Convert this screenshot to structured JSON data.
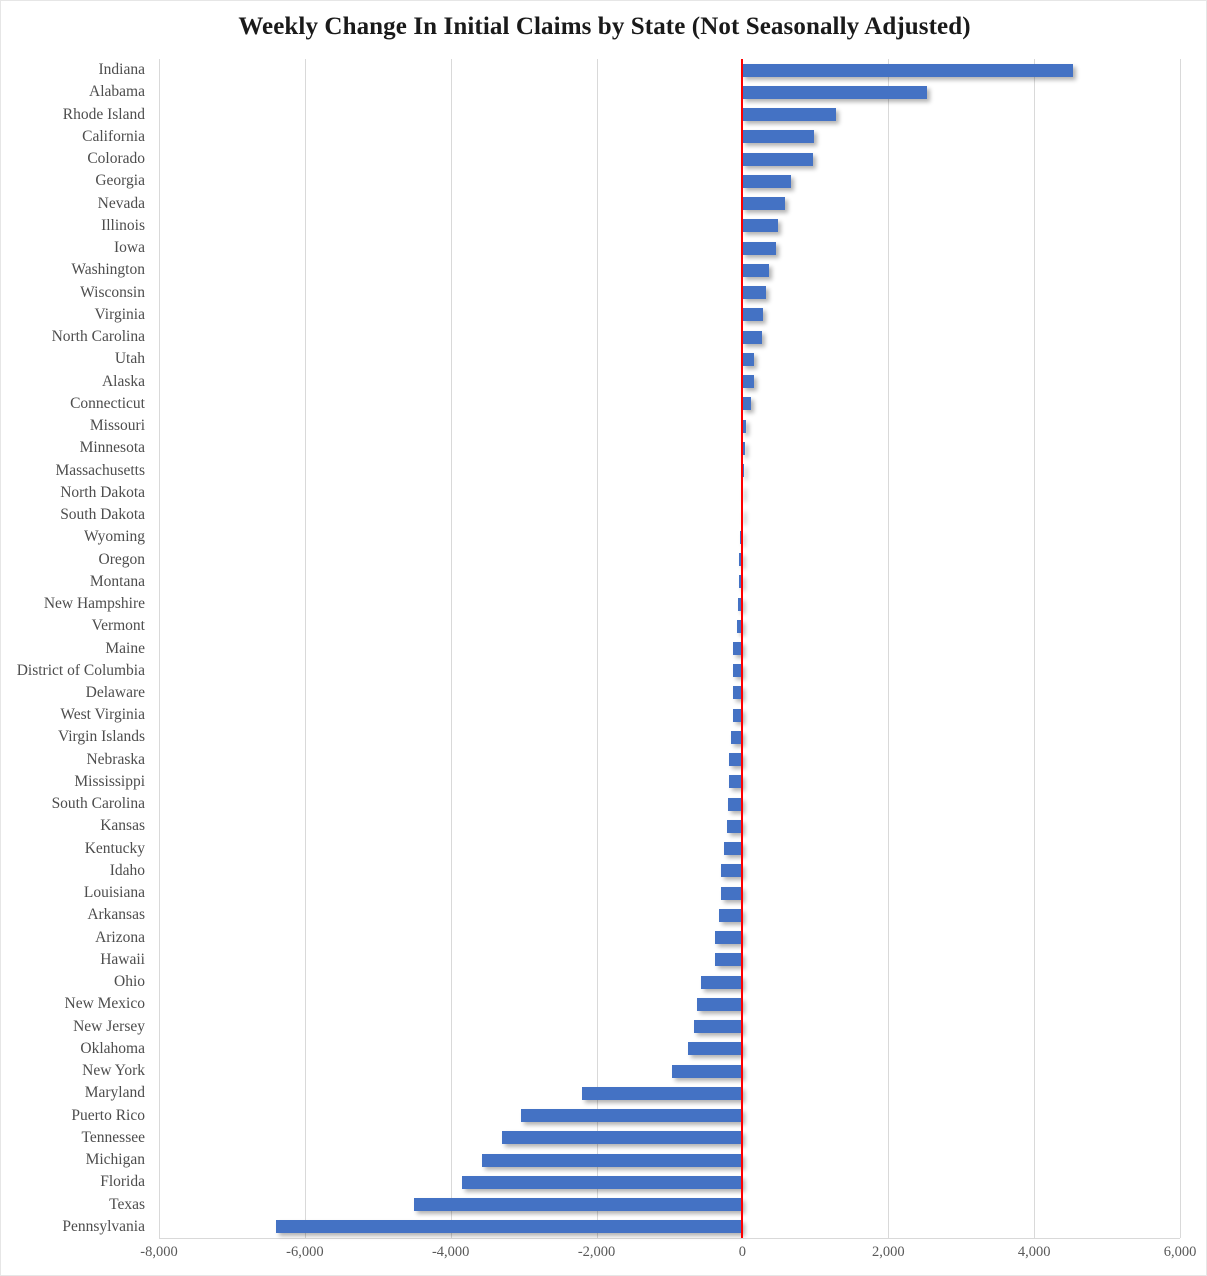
{
  "chart_data": {
    "type": "bar",
    "orientation": "horizontal",
    "title": "Weekly Change In Initial Claims by State (Not Seasonally Adjusted)",
    "xlabel": "",
    "ylabel": "",
    "xlim": [
      -8000,
      6000
    ],
    "xticks": [
      -8000,
      -6000,
      -4000,
      -2000,
      0,
      2000,
      4000,
      6000
    ],
    "xtick_labels": [
      "-8,000",
      "-6,000",
      "-4,000",
      "-2,000",
      "0",
      "2,000",
      "4,000",
      "6,000"
    ],
    "grid": true,
    "legend": "none",
    "bar_color": "#4472C4",
    "zero_line_color": "#FF0000",
    "categories": [
      "Indiana",
      "Alabama",
      "Rhode Island",
      "California",
      "Colorado",
      "Georgia",
      "Nevada",
      "Illinois",
      "Iowa",
      "Washington",
      "Wisconsin",
      "Virginia",
      "North Carolina",
      "Utah",
      "Alaska",
      "Connecticut",
      "Missouri",
      "Minnesota",
      "Massachusetts",
      "North Dakota",
      "South Dakota",
      "Wyoming",
      "Oregon",
      "Montana",
      "New Hampshire",
      "Vermont",
      "Maine",
      "District of Columbia",
      "Delaware",
      "West Virginia",
      "Virgin Islands",
      "Nebraska",
      "Mississippi",
      "South Carolina",
      "Kansas",
      "Kentucky",
      "Idaho",
      "Louisiana",
      "Arkansas",
      "Arizona",
      "Hawaii",
      "Ohio",
      "New Mexico",
      "New Jersey",
      "Oklahoma",
      "New York",
      "Maryland",
      "Puerto Rico",
      "Tennessee",
      "Michigan",
      "Florida",
      "Texas",
      "Pennsylvania"
    ],
    "values": [
      4528,
      2528,
      1290,
      986,
      972,
      667,
      583,
      486,
      458,
      361,
      319,
      278,
      264,
      153,
      153,
      111,
      55,
      42,
      14,
      -14,
      -14,
      -28,
      -42,
      -42,
      -56,
      -69,
      -125,
      -125,
      -125,
      -125,
      -153,
      -180,
      -180,
      -194,
      -208,
      -250,
      -292,
      -292,
      -319,
      -375,
      -375,
      -569,
      -625,
      -667,
      -750,
      -972,
      -2194,
      -3042,
      -3292,
      -3569,
      -3847,
      -4500,
      -6389
    ]
  }
}
